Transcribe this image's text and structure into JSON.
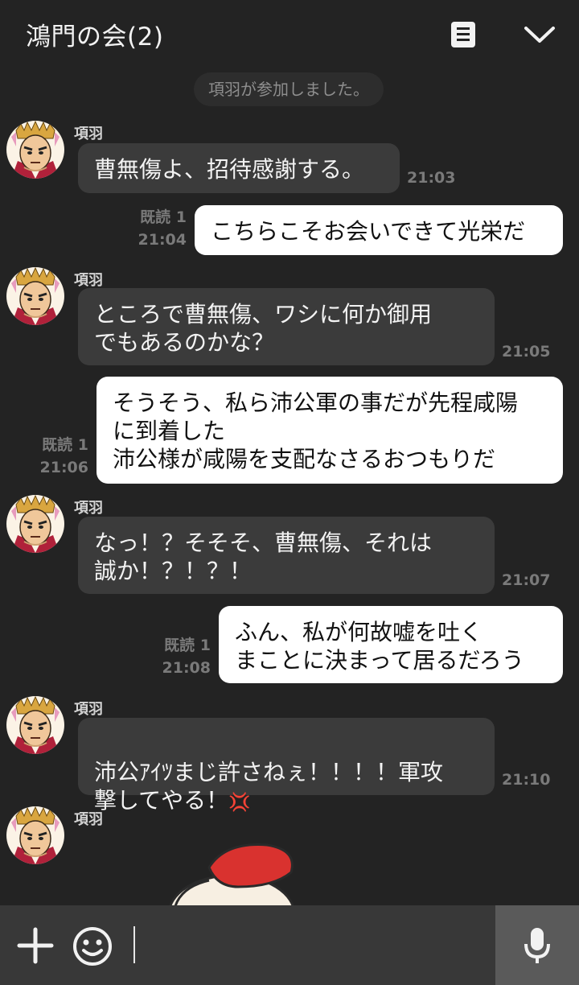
{
  "header": {
    "title": "鴻門の会(2)",
    "note_icon": "note-icon",
    "collapse_icon": "chevron-down-icon"
  },
  "system_message": "項羽が参加しました。",
  "messages": [
    {
      "sender": "項羽",
      "text": "曹無傷よ、招待感謝する。",
      "time": "21:03"
    },
    {
      "read": "既読 1",
      "text": "こちらこそお会いできて光栄だ",
      "time": "21:04"
    },
    {
      "sender": "項羽",
      "text": "ところで曹無傷、ワシに何か御用\nでもあるのかな？",
      "time": "21:05"
    },
    {
      "read": "既読 1",
      "text": "そうそう、私ら沛公軍の事だが先程咸陽\nに到着した\n沛公様が咸陽を支配なさるおつもりだ",
      "time": "21:06"
    },
    {
      "sender": "項羽",
      "text": "なっ！？そそそ、曹無傷、それは\n誠か！？！？！",
      "time": "21:07"
    },
    {
      "read": "既読 1",
      "text": "ふん、私が何故嘘を吐く\nまことに決まって居るだろう",
      "time": "21:08"
    },
    {
      "sender": "項羽",
      "text": "沛公ｱｲﾂまじ許さねぇ！！！！軍攻\n撃してやる！",
      "emoji": "💢",
      "time": "21:10"
    },
    {
      "sender": "項羽",
      "sticker": "sticker-image"
    }
  ],
  "footer": {
    "placeholder": "",
    "plus_icon": "plus-icon",
    "emoji_icon": "emoji-icon",
    "mic_icon": "microphone-icon"
  },
  "colors": {
    "background": "#232323",
    "incoming_bubble": "#3b3b3b",
    "outgoing_bubble": "#ffffff",
    "footer": "#383838",
    "mic_button": "#5a5a5a",
    "anger_red": "#e0332f"
  }
}
